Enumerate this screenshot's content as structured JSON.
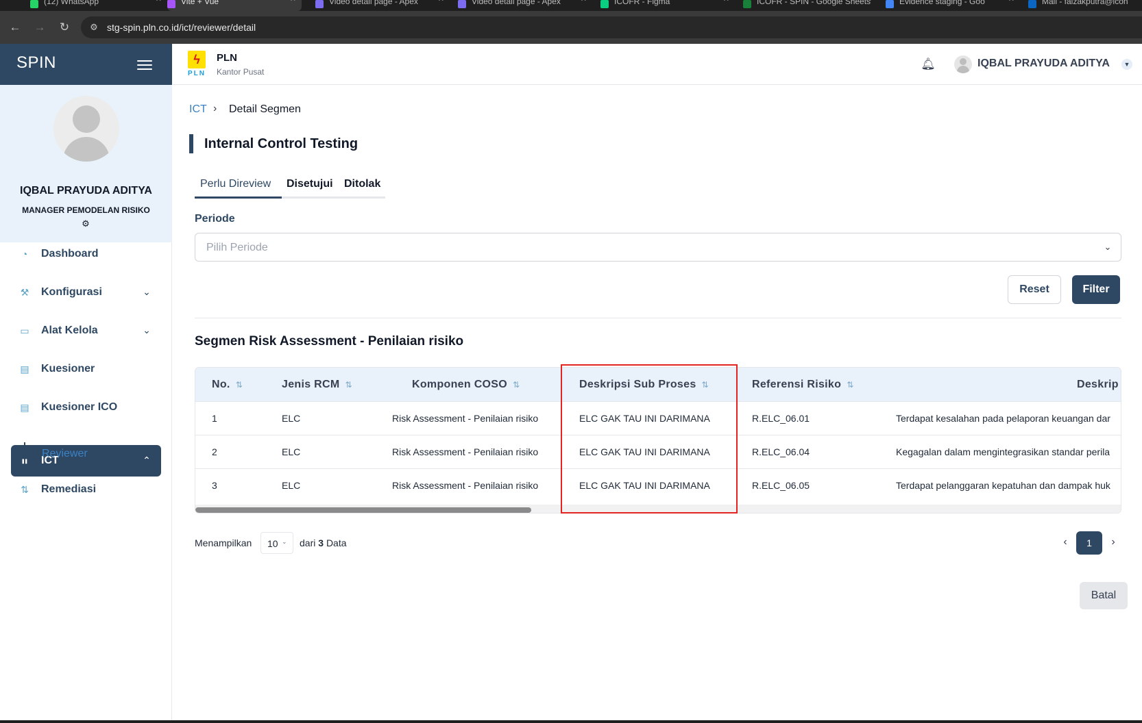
{
  "browser": {
    "tabs": [
      {
        "label": "(12) WhatsApp",
        "icon": "whatsapp-icon",
        "color": "#25d366"
      },
      {
        "label": "Vite + Vue",
        "icon": "vite-icon",
        "color": "#a855f7"
      },
      {
        "label": "Video detail page - Apex",
        "icon": "apex-icon",
        "color": "#7c6cf0"
      },
      {
        "label": "Video detail page - Apex",
        "icon": "apex-icon",
        "color": "#7c6cf0"
      },
      {
        "label": "ICOFR - Figma",
        "icon": "figma-icon",
        "color": "#0acf83"
      },
      {
        "label": "ICOFR - SPIN - Google Sheets",
        "icon": "sheets-icon",
        "color": "#188038"
      },
      {
        "label": "Evidence staging - Goo",
        "icon": "docs-icon",
        "color": "#4285f4"
      },
      {
        "label": "Mail - faizakputra@icon",
        "icon": "mail-icon",
        "color": "#0a66c2"
      }
    ],
    "url": "stg-spin.pln.co.id/ict/reviewer/detail"
  },
  "sidebar": {
    "brand": "SPIN",
    "profile": {
      "name": "IQBAL PRAYUDA ADITYA",
      "role": "MANAGER PEMODELAN RISIKO"
    },
    "menu": [
      {
        "label": "Dashboard",
        "icon": "dashboard-icon",
        "has_children": false,
        "active": false
      },
      {
        "label": "Konfigurasi",
        "icon": "wrench-icon",
        "has_children": true,
        "active": false
      },
      {
        "label": "Alat Kelola",
        "icon": "monitor-icon",
        "has_children": true,
        "active": false
      },
      {
        "label": "Kuesioner",
        "icon": "clipboard-icon",
        "has_children": false,
        "active": false
      },
      {
        "label": "Kuesioner ICO",
        "icon": "clipboard-icon",
        "has_children": false,
        "active": false
      },
      {
        "label": "ICT",
        "icon": "lock-icon",
        "has_children": true,
        "active": true
      },
      {
        "label": "Remediasi",
        "icon": "arrows-icon",
        "has_children": false,
        "active": false
      }
    ],
    "submenu": {
      "label": "Reviewer"
    }
  },
  "header": {
    "logo_text": "PLN",
    "org_name": "PLN",
    "org_sub": "Kantor Pusat",
    "user_name": "IQBAL PRAYUDA ADITYA"
  },
  "main": {
    "breadcrumb": {
      "root": "ICT",
      "current": "Detail Segmen"
    },
    "title": "Internal Control Testing",
    "tabs": [
      {
        "label": "Perlu Direview",
        "active": true
      },
      {
        "label": "Disetujui",
        "active": false
      },
      {
        "label": "Ditolak",
        "active": false
      }
    ],
    "filter": {
      "periode_label": "Periode",
      "periode_placeholder": "Pilih Periode",
      "reset_label": "Reset",
      "filter_label": "Filter"
    },
    "section_title": "Segmen Risk Assessment - Penilaian risiko",
    "table": {
      "columns": [
        "No.",
        "Jenis RCM",
        "Komponen COSO",
        "Deskripsi Sub Proses",
        "Referensi Risiko",
        "Deskrip"
      ],
      "rows": [
        [
          "1",
          "ELC",
          "Risk Assessment - Penilaian risiko",
          "ELC GAK TAU INI DARIMANA",
          "R.ELC_06.01",
          "Terdapat kesalahan pada pelaporan keuangan dar"
        ],
        [
          "2",
          "ELC",
          "Risk Assessment - Penilaian risiko",
          "ELC GAK TAU INI DARIMANA",
          "R.ELC_06.04",
          "Kegagalan dalam mengintegrasikan standar perila"
        ],
        [
          "3",
          "ELC",
          "Risk Assessment - Penilaian risiko",
          "ELC GAK TAU INI DARIMANA",
          "R.ELC_06.05",
          "Terdapat pelanggaran kepatuhan dan dampak huk"
        ]
      ]
    },
    "pagination": {
      "show_label": "Menampilkan",
      "page_size": "10",
      "count_prefix": "dari",
      "total": "3",
      "count_suffix": "Data",
      "current_page": "1"
    },
    "cancel_label": "Batal"
  },
  "colors": {
    "primary": "#2e4863",
    "link": "#3b82c4",
    "highlight": "#e32222",
    "header_bg": "#e9f2fb"
  }
}
